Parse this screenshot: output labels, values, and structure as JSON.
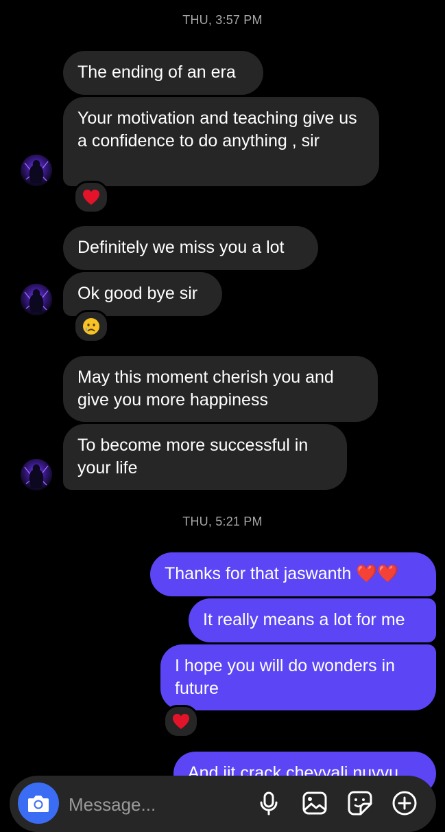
{
  "thread": {
    "timestamps": [
      "THU, 3:57 PM",
      "THU, 5:21 PM"
    ],
    "received": [
      {
        "text": "The ending of an era"
      },
      {
        "text": "Your motivation and teaching give us a confidence to do anything , sir",
        "reaction": "red-heart"
      },
      {
        "text": "Definitely we miss you a lot"
      },
      {
        "text": "Ok good bye sir",
        "reaction": "crying-face"
      },
      {
        "text": "May this moment cherish you and give you more happiness"
      },
      {
        "text": "To become more successful in your life"
      }
    ],
    "sent": [
      {
        "text": "Thanks for that jaswanth ❤️❤️"
      },
      {
        "text": "It really means a lot for me"
      },
      {
        "text": "I hope you will do wonders in future",
        "reaction": "red-heart"
      },
      {
        "text": "And iit crack cheyyali nuvvu"
      }
    ]
  },
  "composer": {
    "placeholder": "Message..."
  },
  "colors": {
    "background": "#000000",
    "incoming_bubble": "#262626",
    "outgoing_bubble": "#5b45f5",
    "camera_button": "#3b6df4",
    "timestamp": "#a8a8a8"
  },
  "icons": [
    "camera-icon",
    "microphone-icon",
    "gallery-icon",
    "sticker-icon",
    "plus-icon"
  ]
}
